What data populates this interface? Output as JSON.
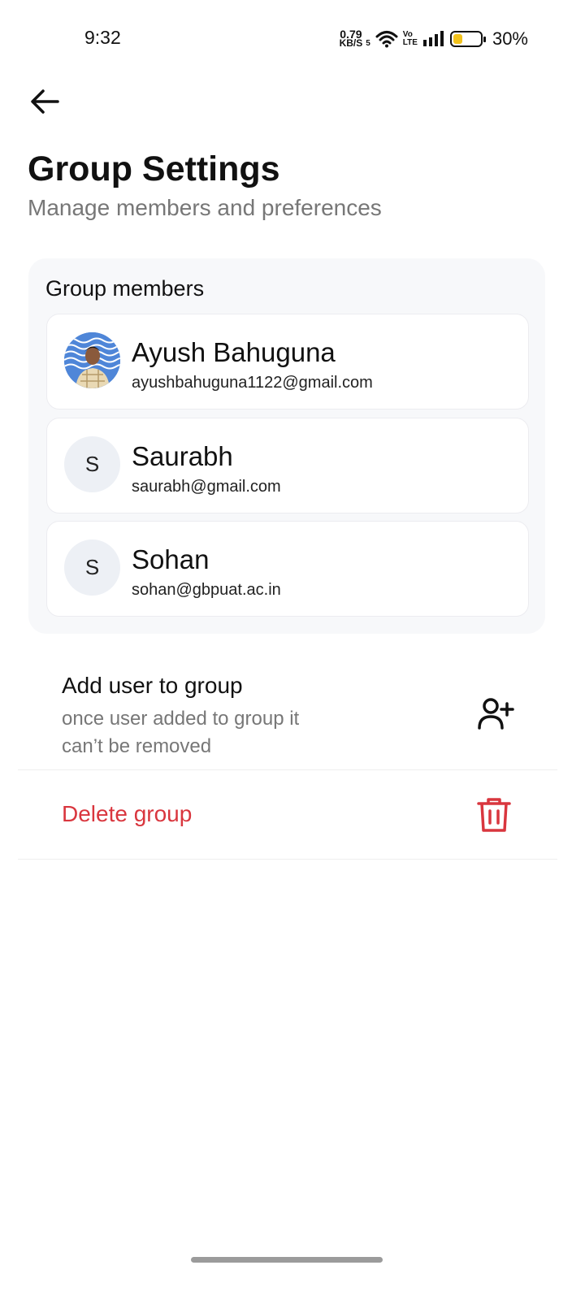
{
  "status_bar": {
    "time": "9:32",
    "net_speed_value": "0.79",
    "net_speed_unit": "KB/S",
    "wifi_gen": "5",
    "volte_top": "Vo",
    "volte_bottom": "LTE",
    "battery_pct": "30%",
    "battery_level": 0.3,
    "battery_color": "#f2c21b"
  },
  "header": {
    "title": "Group Settings",
    "subtitle": "Manage members and preferences"
  },
  "members": {
    "section_title": "Group members",
    "items": [
      {
        "name": "Ayush Bahuguna",
        "email": "ayushbahuguna1122@gmail.com",
        "avatar_initial": "",
        "avatar_type": "photo"
      },
      {
        "name": "Saurabh",
        "email": "saurabh@gmail.com",
        "avatar_initial": "S",
        "avatar_type": "initial"
      },
      {
        "name": "Sohan",
        "email": "sohan@gbpuat.ac.in",
        "avatar_initial": "S",
        "avatar_type": "initial"
      }
    ]
  },
  "actions": {
    "add_user": {
      "title": "Add user to group",
      "description": "once user added to group it can’t be removed",
      "icon": "add-user-icon"
    },
    "delete_group": {
      "label": "Delete group",
      "icon": "trash-icon",
      "color": "#d9363e"
    }
  }
}
